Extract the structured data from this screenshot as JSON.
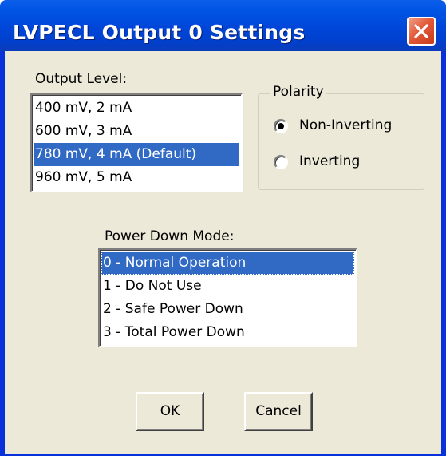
{
  "window": {
    "title": "LVPECL Output 0 Settings",
    "close_icon": "close-icon"
  },
  "output_level": {
    "label": "Output Level:",
    "items": [
      {
        "text": "400 mV, 2 mA",
        "selected": false
      },
      {
        "text": "600 mV, 3 mA",
        "selected": false
      },
      {
        "text": "780 mV, 4 mA (Default)",
        "selected": true
      },
      {
        "text": "960 mV, 5 mA",
        "selected": false
      }
    ]
  },
  "polarity": {
    "title": "Polarity",
    "options": [
      {
        "label": "Non-Inverting",
        "checked": true
      },
      {
        "label": "Inverting",
        "checked": false
      }
    ]
  },
  "power_down": {
    "label": "Power Down Mode:",
    "items": [
      {
        "text": "0 - Normal Operation",
        "selected": true
      },
      {
        "text": "1 - Do Not Use",
        "selected": false
      },
      {
        "text": "2 - Safe Power Down",
        "selected": false
      },
      {
        "text": "3 - Total Power Down",
        "selected": false
      }
    ]
  },
  "buttons": {
    "ok": "OK",
    "cancel": "Cancel"
  },
  "colors": {
    "titlebar": "#0046d8",
    "selection": "#316ac5",
    "dialog_face": "#ece9d8",
    "close_button": "#e35a3a"
  }
}
